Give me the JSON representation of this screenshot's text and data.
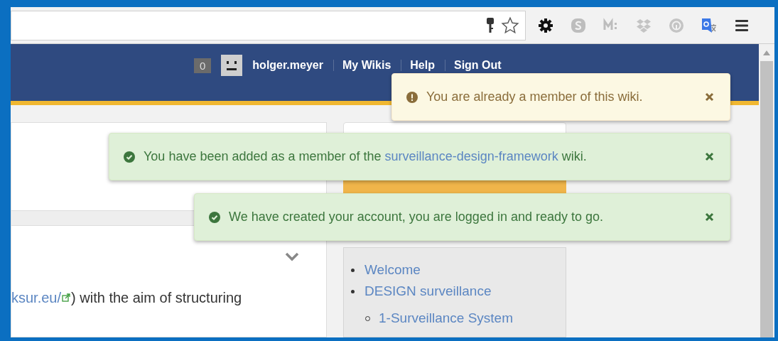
{
  "header": {
    "notification_count": "0",
    "username": "holger.meyer",
    "links": [
      {
        "label": "My Wikis"
      },
      {
        "label": "Help"
      },
      {
        "label": "Sign Out"
      }
    ]
  },
  "alerts": [
    {
      "kind": "warning",
      "parts": [
        {
          "kind": "text",
          "text": "You are already a member of this wiki."
        }
      ]
    },
    {
      "kind": "success",
      "parts": [
        {
          "kind": "text",
          "text": "You have been added as a member of the "
        },
        {
          "kind": "link",
          "text": "surveillance-design-framework"
        },
        {
          "kind": "text",
          "text": " wiki."
        }
      ]
    },
    {
      "kind": "success",
      "parts": [
        {
          "kind": "text",
          "text": "We have created your account, you are logged in and ready to go."
        }
      ]
    }
  ],
  "content": {
    "link": "ksur.eu/",
    "text": ") with the aim of structuring"
  },
  "sidebar": {
    "nav": [
      {
        "label": "Welcome"
      },
      {
        "label": "DESIGN surveillance",
        "children": [
          {
            "label": "1-Surveillance System"
          }
        ]
      }
    ]
  }
}
